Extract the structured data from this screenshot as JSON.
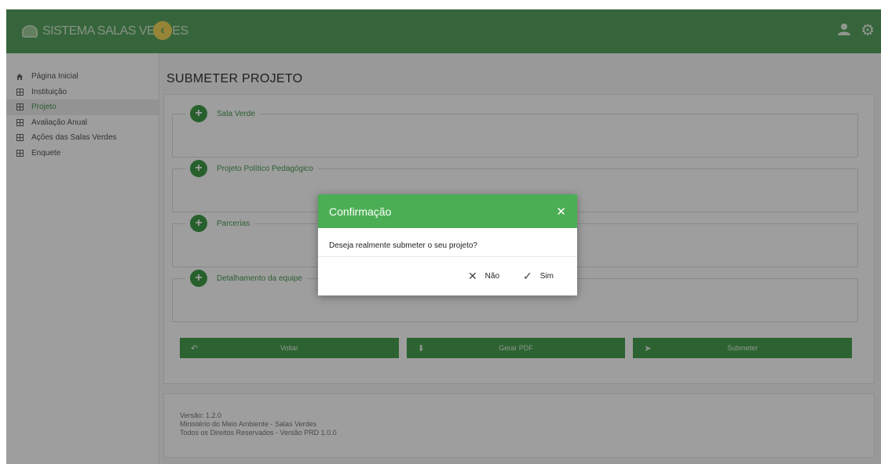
{
  "header": {
    "brand": "SISTEMA SALAS VERDES",
    "collapse_icon": "chevron-left-icon",
    "user_icon": "user-icon",
    "settings_icon": "gear-icon"
  },
  "sidebar": {
    "items": [
      {
        "label": "Página Inicial",
        "icon": "home-icon"
      },
      {
        "label": "Instituição",
        "icon": "grid-icon"
      },
      {
        "label": "Projeto",
        "icon": "grid-icon",
        "active": true
      },
      {
        "label": "Avaliação Anual",
        "icon": "grid-icon"
      },
      {
        "label": "Ações das Salas Verdes",
        "icon": "grid-icon"
      },
      {
        "label": "Enquete",
        "icon": "grid-icon"
      }
    ]
  },
  "main": {
    "title": "SUBMETER PROJETO",
    "sections": [
      {
        "label": "Sala Verde"
      },
      {
        "label": "Projeto Político Pedagógico"
      },
      {
        "label": "Parcerias"
      },
      {
        "label": "Detalhamento da equipe"
      }
    ],
    "actions": {
      "back": "Voltar",
      "pdf": "Gerar PDF",
      "submit": "Submeter"
    },
    "footer": {
      "version": "Versão: 1.2.0",
      "org": "Ministério do Meio Ambiente - Salas Verdes",
      "rights": "Todos os Direitos Reservados - Versão PRD 1.0.0"
    }
  },
  "modal": {
    "title": "Confirmação",
    "message": "Deseja realmente submeter o seu projeto?",
    "no_label": "Não",
    "yes_label": "Sim"
  },
  "colors": {
    "header": "#58a35f",
    "modal_header": "#4cae54",
    "accent_yellow": "#f2d65a"
  }
}
